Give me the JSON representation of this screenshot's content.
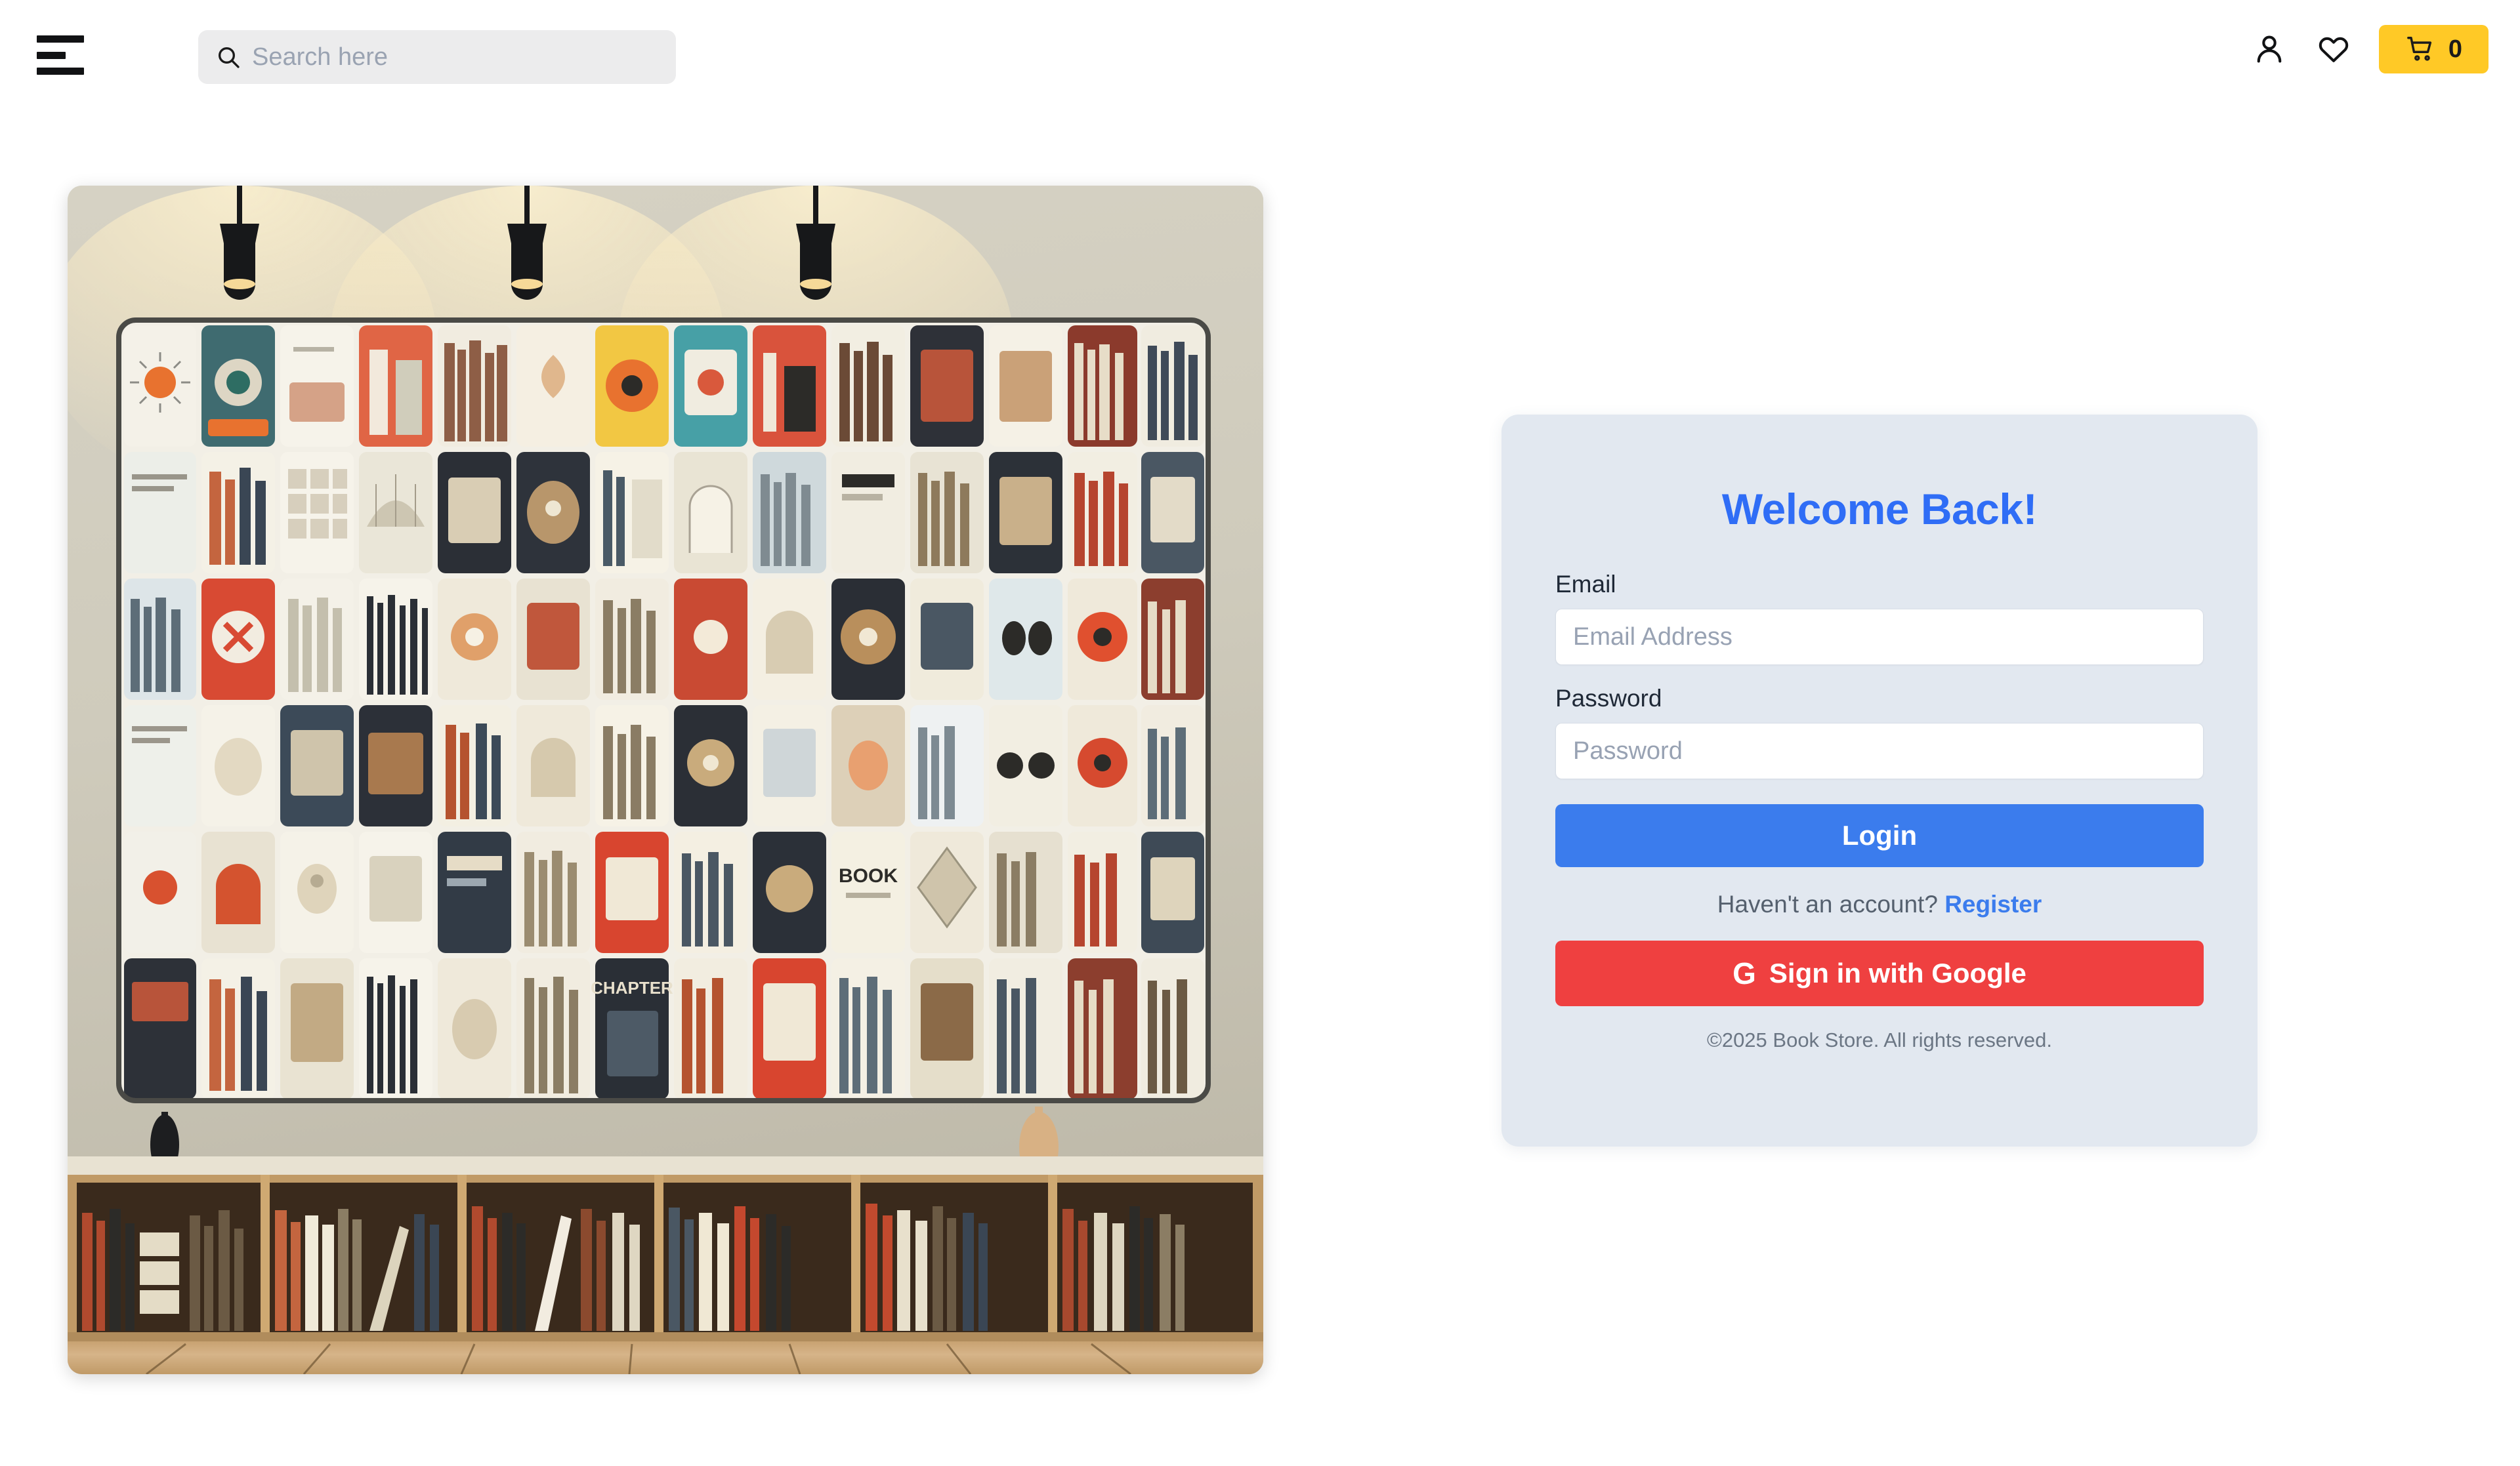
{
  "header": {
    "menu_icon": "hamburger-menu-icon",
    "search": {
      "icon": "search-icon",
      "placeholder": "Search here",
      "value": ""
    },
    "account_icon": "user-account-icon",
    "wishlist_icon": "heart-icon",
    "cart": {
      "icon": "shopping-cart-icon",
      "count": "0",
      "bg_color": "#ffc926"
    }
  },
  "hero": {
    "alt": "bookstore-wall-of-book-covers-with-pendant-lamps",
    "lamp_count": 3
  },
  "login": {
    "title": "Welcome Back!",
    "title_color": "#2f6df6",
    "card_bg": "#e2e8f0",
    "email": {
      "label": "Email",
      "placeholder": "Email Address",
      "value": ""
    },
    "password": {
      "label": "Password",
      "placeholder": "Password",
      "value": ""
    },
    "login_button": {
      "label": "Login",
      "bg_color": "#3b7ced"
    },
    "register_prompt": "Haven't an account?",
    "register_link": "Register",
    "google_button": {
      "glyph": "G",
      "label": "Sign in with Google",
      "bg_color": "#ef4040"
    },
    "copyright": "©2025 Book Store. All rights reserved."
  }
}
